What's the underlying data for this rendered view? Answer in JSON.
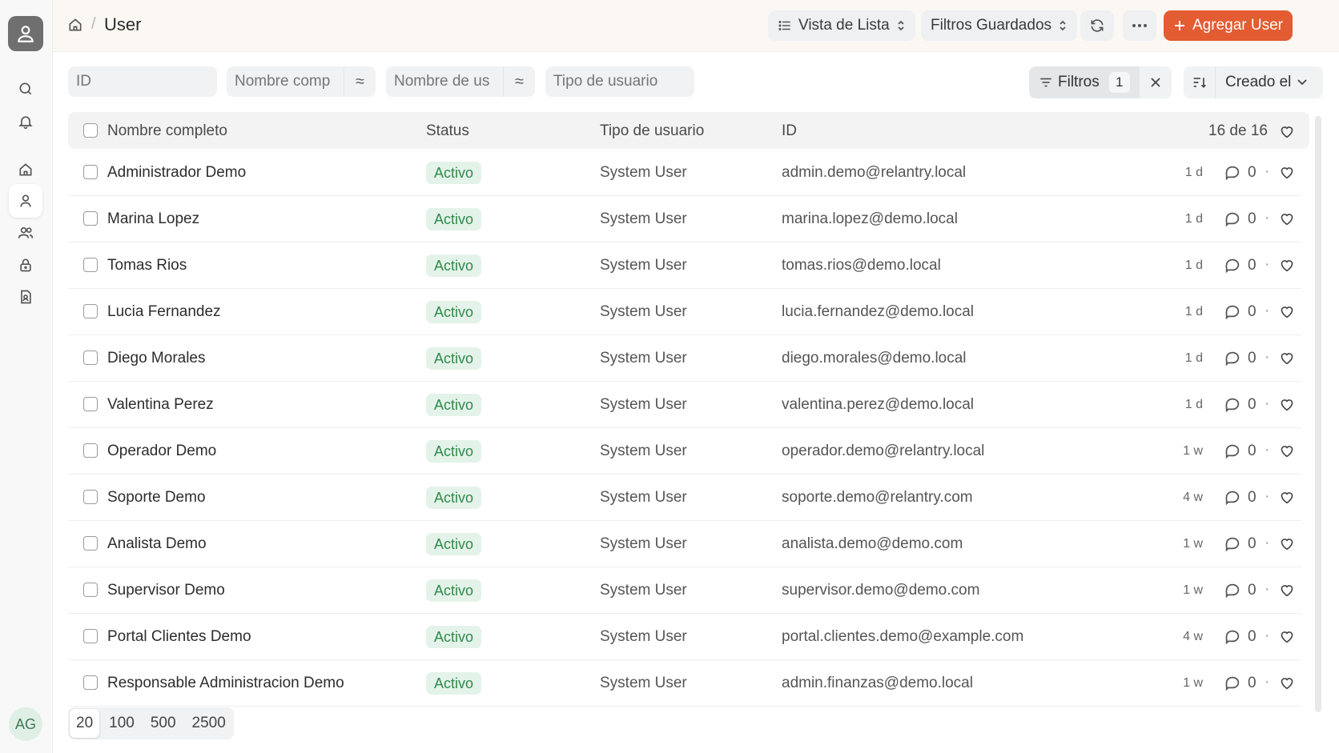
{
  "breadcrumb": {
    "title": "User"
  },
  "header": {
    "view_label": "Vista de Lista",
    "saved_filters_label": "Filtros Guardados",
    "add_label": "Agregar User"
  },
  "filters": {
    "id_placeholder": "ID",
    "name_placeholder": "Nombre comp",
    "username_placeholder": "Nombre de us",
    "usertype_placeholder": "Tipo de usuario",
    "operator_symbol": "≈",
    "filters_label": "Filtros",
    "filters_count": "1",
    "sort_label": "Creado el"
  },
  "table": {
    "columns": [
      "Nombre completo",
      "Status",
      "Tipo de usuario",
      "ID"
    ],
    "record_count": "16 de 16",
    "rows": [
      {
        "name": "Administrador Demo",
        "status": "Activo",
        "type": "System User",
        "id": "admin.demo@relantry.local",
        "time": "1 d",
        "comments": "0"
      },
      {
        "name": "Marina Lopez",
        "status": "Activo",
        "type": "System User",
        "id": "marina.lopez@demo.local",
        "time": "1 d",
        "comments": "0"
      },
      {
        "name": "Tomas Rios",
        "status": "Activo",
        "type": "System User",
        "id": "tomas.rios@demo.local",
        "time": "1 d",
        "comments": "0"
      },
      {
        "name": "Lucia Fernandez",
        "status": "Activo",
        "type": "System User",
        "id": "lucia.fernandez@demo.local",
        "time": "1 d",
        "comments": "0"
      },
      {
        "name": "Diego Morales",
        "status": "Activo",
        "type": "System User",
        "id": "diego.morales@demo.local",
        "time": "1 d",
        "comments": "0"
      },
      {
        "name": "Valentina Perez",
        "status": "Activo",
        "type": "System User",
        "id": "valentina.perez@demo.local",
        "time": "1 d",
        "comments": "0"
      },
      {
        "name": "Operador Demo",
        "status": "Activo",
        "type": "System User",
        "id": "operador.demo@relantry.local",
        "time": "1 w",
        "comments": "0"
      },
      {
        "name": "Soporte Demo",
        "status": "Activo",
        "type": "System User",
        "id": "soporte.demo@relantry.com",
        "time": "4 w",
        "comments": "0"
      },
      {
        "name": "Analista Demo",
        "status": "Activo",
        "type": "System User",
        "id": "analista.demo@demo.com",
        "time": "1 w",
        "comments": "0"
      },
      {
        "name": "Supervisor Demo",
        "status": "Activo",
        "type": "System User",
        "id": "supervisor.demo@demo.com",
        "time": "1 w",
        "comments": "0"
      },
      {
        "name": "Portal Clientes Demo",
        "status": "Activo",
        "type": "System User",
        "id": "portal.clientes.demo@example.com",
        "time": "4 w",
        "comments": "0"
      },
      {
        "name": "Responsable Administracion Demo",
        "status": "Activo",
        "type": "System User",
        "id": "admin.finanzas@demo.local",
        "time": "1 w",
        "comments": "0"
      }
    ]
  },
  "page_sizes": [
    "20",
    "100",
    "500",
    "2500"
  ],
  "page_size_selected": "20",
  "user": {
    "initials": "AG"
  },
  "colors": {
    "accent": "#e35c32",
    "status_active_bg": "#e4f3e9",
    "status_active_text": "#2f8a4c"
  }
}
